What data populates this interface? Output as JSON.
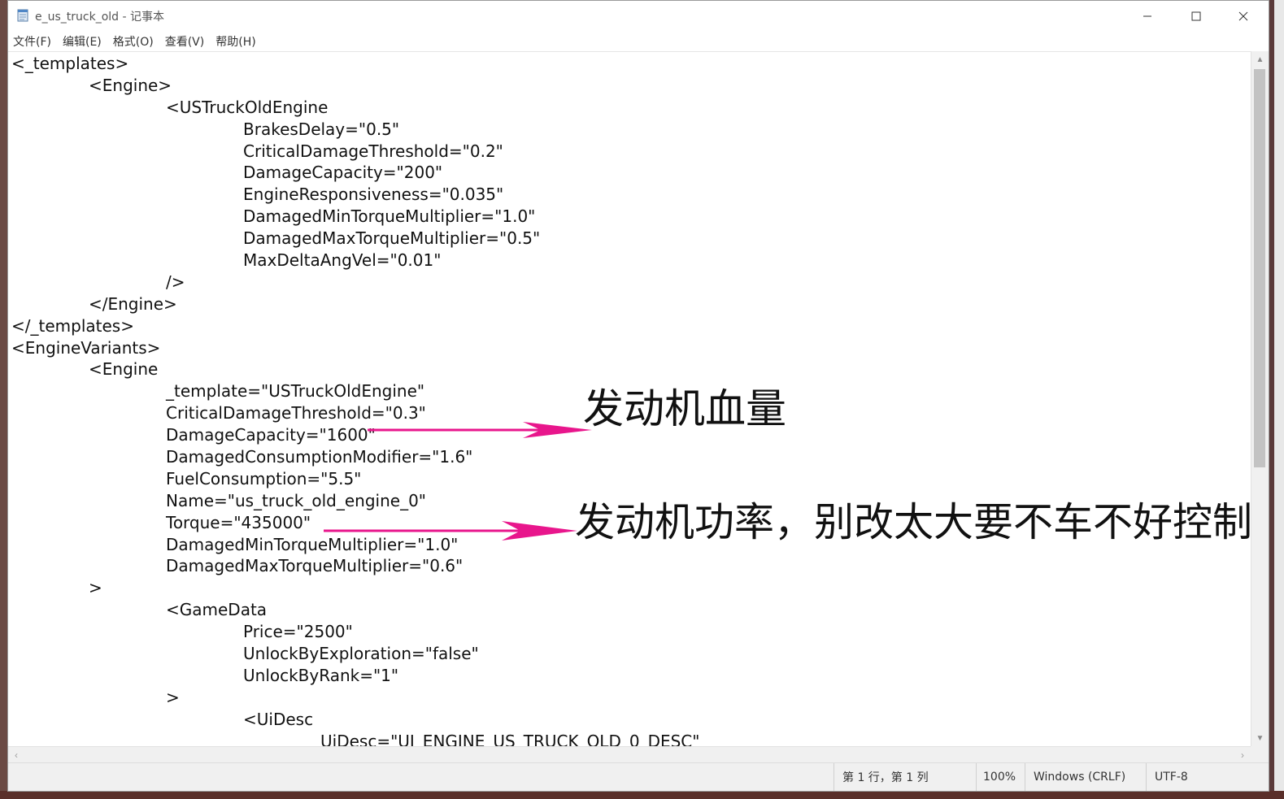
{
  "window": {
    "title": "e_us_truck_old - 记事本",
    "icons": {
      "app": "notepad-icon",
      "minimize": "minimize-icon",
      "maximize": "maximize-icon",
      "close": "close-icon"
    }
  },
  "menu": {
    "items": [
      "文件(F)",
      "编辑(E)",
      "格式(O)",
      "查看(V)",
      "帮助(H)"
    ]
  },
  "editor": {
    "lines": [
      "<_templates>",
      "\t<Engine>",
      "\t\t<USTruckOldEngine",
      "\t\t\tBrakesDelay=\"0.5\"",
      "\t\t\tCriticalDamageThreshold=\"0.2\"",
      "\t\t\tDamageCapacity=\"200\"",
      "\t\t\tEngineResponsiveness=\"0.035\"",
      "\t\t\tDamagedMinTorqueMultiplier=\"1.0\"",
      "\t\t\tDamagedMaxTorqueMultiplier=\"0.5\"",
      "\t\t\tMaxDeltaAngVel=\"0.01\"",
      "\t\t/>",
      "\t</Engine>",
      "</_templates>",
      "<EngineVariants>",
      "\t<Engine",
      "\t\t_template=\"USTruckOldEngine\"",
      "\t\tCriticalDamageThreshold=\"0.3\"",
      "\t\tDamageCapacity=\"1600\"",
      "\t\tDamagedConsumptionModifier=\"1.6\"",
      "\t\tFuelConsumption=\"5.5\"",
      "\t\tName=\"us_truck_old_engine_0\"",
      "\t\tTorque=\"435000\"",
      "\t\tDamagedMinTorqueMultiplier=\"1.0\"",
      "\t\tDamagedMaxTorqueMultiplier=\"0.6\"",
      "\t>",
      "\t\t<GameData",
      "\t\t\tPrice=\"2500\"",
      "\t\t\tUnlockByExploration=\"false\"",
      "\t\t\tUnlockByRank=\"1\"",
      "\t\t>",
      "\t\t\t<UiDesc",
      "\t\t\t\tUiDesc=\"UI_ENGINE_US_TRUCK_OLD_0_DESC\""
    ]
  },
  "annotations": {
    "health_label": "发动机血量",
    "power_label": "发动机功率，别改太大要不车不好控制",
    "arrow_color": "#e8168c"
  },
  "status": {
    "position": "第 1 行，第 1 列",
    "zoom": "100%",
    "line_ending": "Windows (CRLF)",
    "encoding": "UTF-8"
  }
}
